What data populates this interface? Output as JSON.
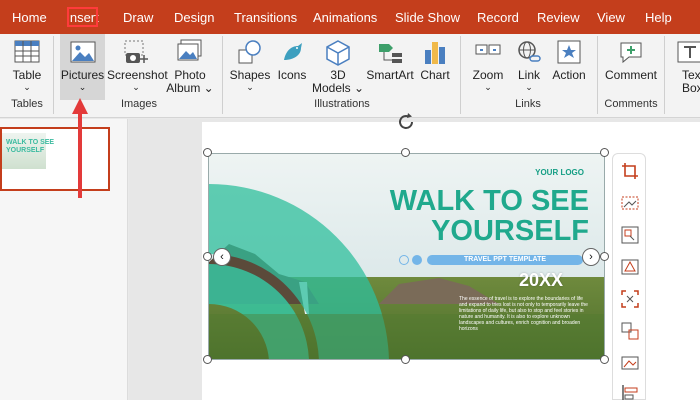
{
  "tabs": [
    "Home",
    "Insert",
    "Draw",
    "Design",
    "Transitions",
    "Animations",
    "Slide Show",
    "Record",
    "Review",
    "View",
    "Help"
  ],
  "ribbon": {
    "table": "Table",
    "pictures": "Pictures",
    "screenshot": "Screenshot",
    "photo_album_1": "Photo",
    "photo_album_2": "Album",
    "shapes": "Shapes",
    "icons": "Icons",
    "models_1": "3D",
    "models_2": "Models",
    "smartart": "SmartArt",
    "chart": "Chart",
    "zoom": "Zoom",
    "link": "Link",
    "action": "Action",
    "comment": "Comment",
    "textbox_1": "Tex",
    "textbox_2": "Box",
    "groups": {
      "tables": "Tables",
      "images": "Images",
      "illustrations": "Illustrations",
      "links": "Links",
      "comments": "Comments"
    }
  },
  "thumbnail": {
    "line1": "WALK TO SEE",
    "line2": "YOURSELF"
  },
  "slide": {
    "logo": "YOUR LOGO",
    "title_line1": "WALK TO SEE",
    "title_line2": "YOURSELF",
    "subtitle": "TRAVEL PPT TEMPLATE",
    "year": "20XX",
    "paragraph": "The essence of travel is to explore the boundaries of life and expand to tries lost is not only to temporarily leave the limitations of daily life, but also to stop and feel stories in nature and humanity. It is also to explore unknown landscapes and cultures, enrich cognition and broaden horizons"
  },
  "colors": {
    "accent": "#c43e1c",
    "teal": "#20a98d",
    "arrow": "#e33a3a"
  }
}
